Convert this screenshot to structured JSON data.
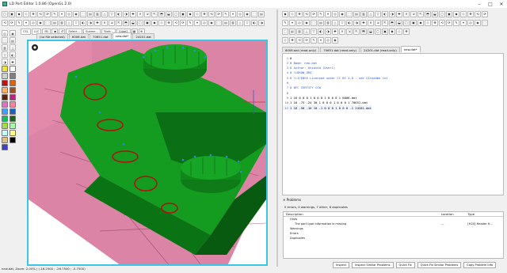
{
  "window": {
    "title": "LD Part Editor 1.0.86 (OpenGL 2.0)"
  },
  "toolbar": {
    "row3_labels": [
      "CSL",
      "LLC",
      "ML",
      "Select...",
      "Subme...",
      "Tools...",
      "Edge2"
    ]
  },
  "colors": {
    "swatches": [
      "#f0e040",
      "#ffffff",
      "#d0d0d0",
      "#808080",
      "#c01010",
      "#e06010",
      "#ffb060",
      "#a05020",
      "#602010",
      "#c02080",
      "#e070c0",
      "#ff80a0",
      "#40a0ff",
      "#2060c0",
      "#10c060",
      "#206020",
      "#a0e040",
      "#a0ffa0",
      "#c0ffff",
      "#ffff80",
      "#e0c080",
      "#000000",
      "#4040c0"
    ]
  },
  "left_tabs": [
    {
      "label": "(no file selected)"
    },
    {
      "label": "6006.dat"
    },
    {
      "label": "70651.dat"
    },
    {
      "label": "new.dat*"
    },
    {
      "label": "24201.dat"
    }
  ],
  "right_tabs": [
    {
      "label": "6006.dat (read-only)"
    },
    {
      "label": "70651.dat (read-only)"
    },
    {
      "label": "24201.dat (read-only)"
    },
    {
      "label": "new.dat*"
    }
  ],
  "editor": {
    "lines": [
      {
        "num": "1",
        "text": "0",
        "color": "#000"
      },
      {
        "num": "2",
        "text": "0 Name: new.dat",
        "color": "#2a5fd0"
      },
      {
        "num": "3",
        "text": "0 Author: Unsaved (User1)",
        "color": "#2a5fd0"
      },
      {
        "num": "4",
        "text": "0 !LDRAW_ORG",
        "color": "#2a5fd0"
      },
      {
        "num": "5",
        "text": "0 !LICENSE Licensed under CC BY 4.0 : see CAreadme.txt",
        "color": "#2a5fd0"
      },
      {
        "num": "6",
        "text": "",
        "color": "#000"
      },
      {
        "num": "7",
        "text": "0 BFC CERTIFY CCW",
        "color": "#2a5fd0"
      },
      {
        "num": "8",
        "text": "",
        "color": "#000"
      },
      {
        "num": "9",
        "text": "1 16 0 0 0 1 0 0 0 1 0 0 0 1 6006.dat",
        "color": "#000"
      },
      {
        "num": "10",
        "text": "1 16 -75 -24 30 1 0 0 0 1 0 0 0 1 70651.dat",
        "color": "#000"
      },
      {
        "num": "11",
        "text": "1 16 -50 -16 10 -1 0 0 0 1 0 0 0 -1 24201.dat",
        "color": "#000"
      }
    ]
  },
  "problems": {
    "header": "Problems",
    "summary": "0 errors, 0 warnings, 7 other, 6 duplicates",
    "columns": [
      "Description",
      "Location",
      "Type"
    ],
    "rows": [
      {
        "desc": "Hints",
        "loc": "",
        "type": ""
      },
      {
        "desc": "The part type information is missing",
        "loc": "---",
        "type": "[H20] Header H..."
      },
      {
        "desc": "Warnings",
        "loc": "",
        "type": ""
      },
      {
        "desc": "Errors",
        "loc": "",
        "type": ""
      },
      {
        "desc": "Duplicates",
        "loc": "",
        "type": ""
      }
    ],
    "buttons": [
      "Inspect",
      "Inspect Similar Problems",
      "Quick Fix",
      "Quick Fix Similar Problems",
      "Copy Problem Info"
    ]
  },
  "status": "new.dat, Zoom: 2.00% | (-16.2500 ; -26.7500 ; -0.7500)"
}
